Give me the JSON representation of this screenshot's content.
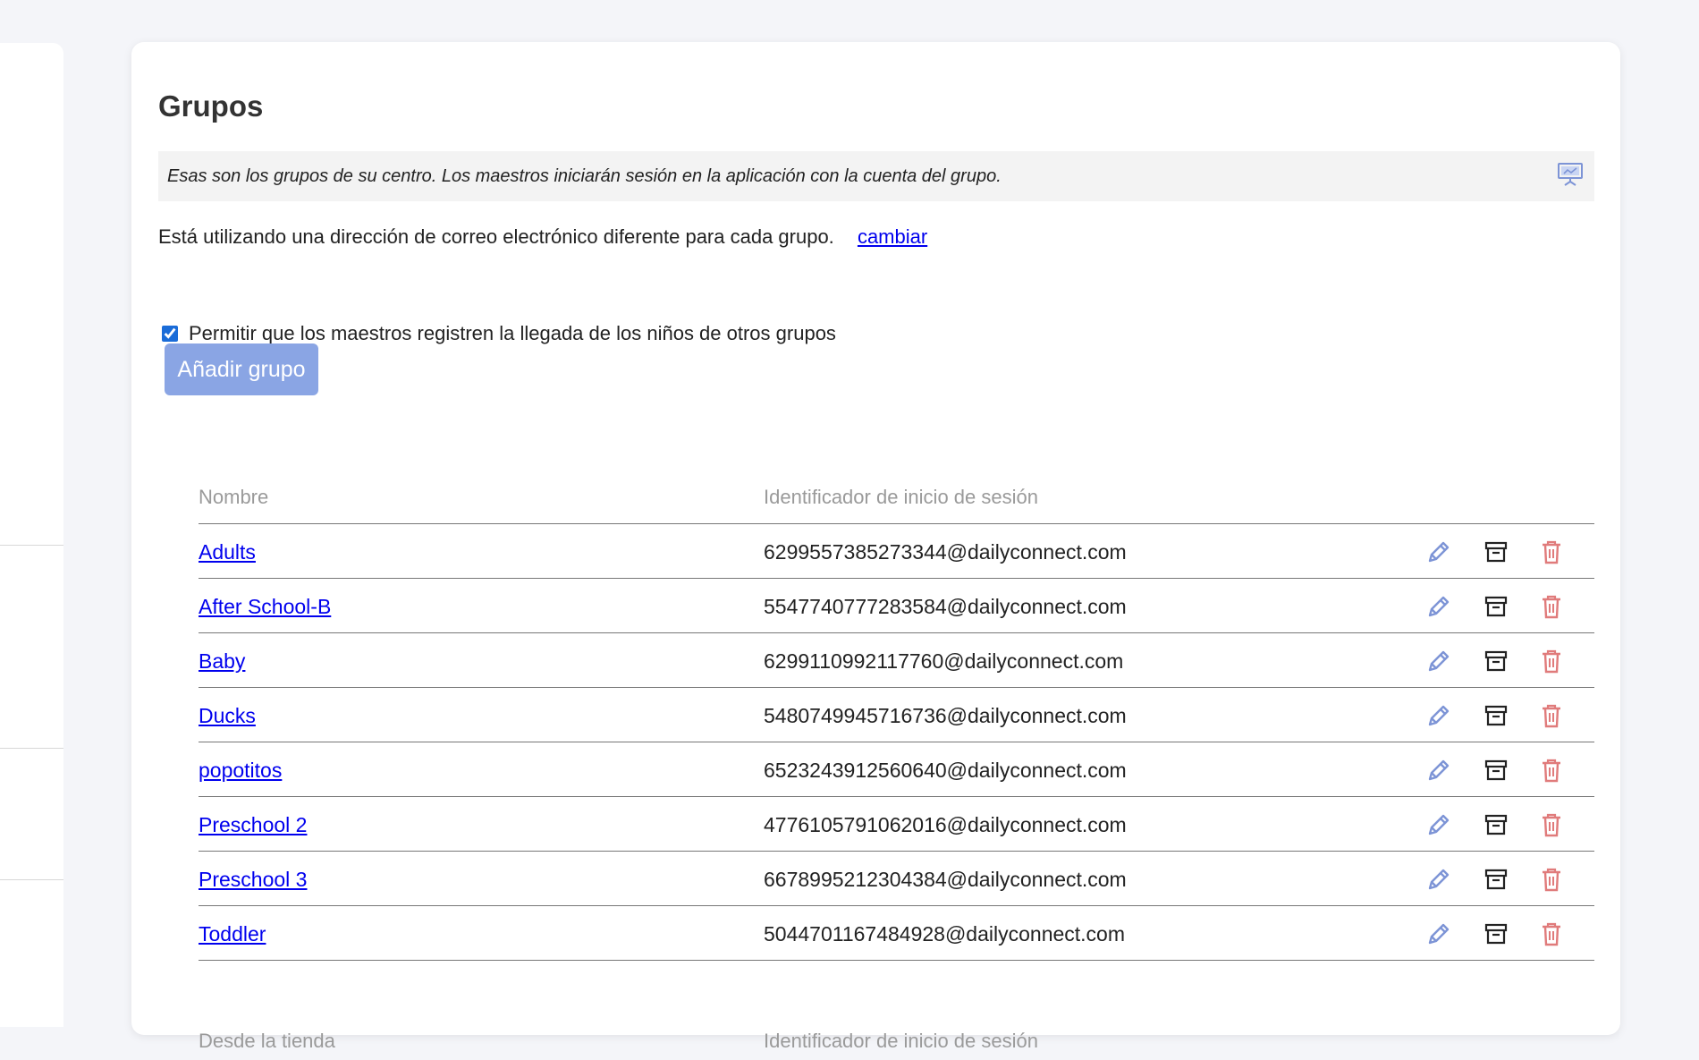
{
  "page": {
    "title": "Grupos"
  },
  "info": {
    "text": "Esas son los grupos de su centro. Los maestros iniciarán sesión en la aplicación con la cuenta del grupo."
  },
  "email_notice": {
    "text": "Está utilizando una dirección de correo electrónico diferente para cada grupo.",
    "link": "cambiar"
  },
  "allow_other_groups": {
    "label": "Permitir que los maestros registren la llegada de los niños de otros grupos",
    "checked": true
  },
  "add_group_button": "Añadir grupo",
  "groups_table": {
    "headers": {
      "name": "Nombre",
      "login": "Identificador de inicio de sesión"
    },
    "rows": [
      {
        "name": "Adults",
        "login": "6299557385273344@dailyconnect.com"
      },
      {
        "name": "After School-B",
        "login": "5547740777283584@dailyconnect.com"
      },
      {
        "name": "Baby",
        "login": "6299110992117760@dailyconnect.com"
      },
      {
        "name": "Ducks",
        "login": "5480749945716736@dailyconnect.com"
      },
      {
        "name": "popotitos",
        "login": "6523243912560640@dailyconnect.com"
      },
      {
        "name": "Preschool 2",
        "login": "4776105791062016@dailyconnect.com"
      },
      {
        "name": "Preschool 3",
        "login": "6678995212304384@dailyconnect.com"
      },
      {
        "name": "Toddler",
        "login": "5044701167484928@dailyconnect.com"
      }
    ]
  },
  "store_table": {
    "headers": {
      "name": "Desde la tienda",
      "login": "Identificador de inicio de sesión"
    }
  },
  "icons": {
    "info": "presentation-icon",
    "edit": "pencil-icon",
    "archive": "archive-icon",
    "delete": "trash-icon"
  },
  "colors": {
    "accent": "#8aa5e4",
    "link": "#0000ee",
    "edit_icon": "#7d94d6",
    "delete_icon": "#e07b7b",
    "archive_icon": "#222222"
  }
}
